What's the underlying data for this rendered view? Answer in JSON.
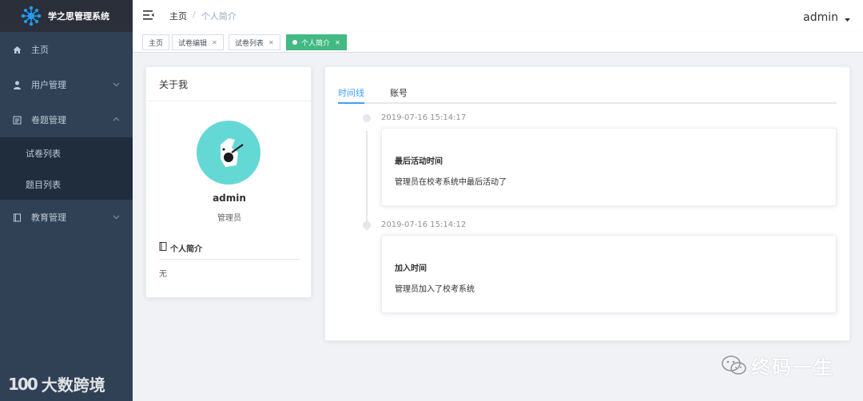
{
  "brand": {
    "title": "学之思管理系统"
  },
  "sidebar": {
    "items": [
      {
        "label": "主页",
        "icon": "home-icon"
      },
      {
        "label": "用户管理",
        "icon": "user-icon"
      },
      {
        "label": "卷题管理",
        "icon": "exam-icon",
        "expanded": true,
        "children": [
          {
            "label": "试卷列表"
          },
          {
            "label": "题目列表"
          }
        ]
      },
      {
        "label": "教育管理",
        "icon": "education-icon"
      }
    ]
  },
  "header": {
    "breadcrumb": [
      "主页",
      "个人简介"
    ],
    "breadcrumb_sep": "/",
    "user": "admin"
  },
  "tags": [
    {
      "label": "主页",
      "closable": false,
      "active": false
    },
    {
      "label": "试卷编辑",
      "closable": true,
      "active": false
    },
    {
      "label": "试卷列表",
      "closable": true,
      "active": false
    },
    {
      "label": "个人简介",
      "closable": true,
      "active": true
    }
  ],
  "about": {
    "title": "关于我",
    "name": "admin",
    "role": "管理员",
    "intro_title": "个人简介",
    "intro_body": "无"
  },
  "profile_tabs": [
    {
      "label": "时间线",
      "active": true
    },
    {
      "label": "账号",
      "active": false
    }
  ],
  "timeline": [
    {
      "time": "2019-07-16 15:14:17",
      "title": "最后活动时间",
      "desc": "管理员在校考系统中最后活动了"
    },
    {
      "time": "2019-07-16 15:14:12",
      "title": "加入时间",
      "desc": "管理员加入了校考系统"
    }
  ],
  "watermarks": {
    "left": "大数跨境",
    "left_logo": "100",
    "right": "终码一生"
  },
  "colors": {
    "sidebar": "#304156",
    "active_tag": "#42b983",
    "accent": "#409eff",
    "avatar_bg": "#64d8d4"
  }
}
